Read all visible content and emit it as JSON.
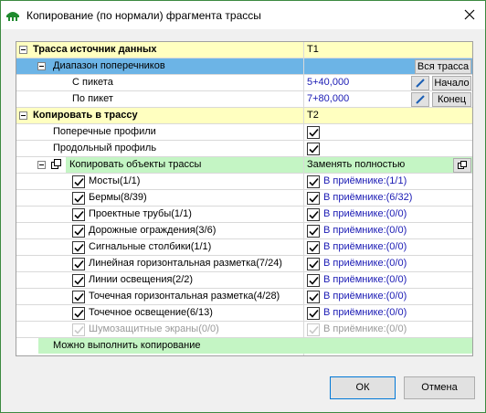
{
  "window": {
    "title": "Копирование (по нормали) фрагмента трассы"
  },
  "rows": {
    "source_label": "Трасса источник данных",
    "source_value": "Т1",
    "range_label": "Диапазон поперечников",
    "range_button": "Вся трасса",
    "from_label": "С пикета",
    "from_value": "5+40,000",
    "from_button": "Начало",
    "to_label": "По пикет",
    "to_value": "7+80,000",
    "to_button": "Конец",
    "target_label": "Копировать в трассу",
    "target_value": "Т2",
    "cross_label": "Поперечные профили",
    "long_label": "Продольный профиль",
    "copy_objects_label": "Копировать объекты трассы",
    "copy_objects_value": "Заменять полностью",
    "footer_label": "Можно выполнить копирование"
  },
  "objects": [
    {
      "label": "Мосты(1/1)",
      "value": "В приёмнике:(1/1)",
      "checked": true,
      "disabled": false
    },
    {
      "label": "Бермы(8/39)",
      "value": "В приёмнике:(6/32)",
      "checked": true,
      "disabled": false
    },
    {
      "label": "Проектные трубы(1/1)",
      "value": "В приёмнике:(0/0)",
      "checked": true,
      "disabled": false
    },
    {
      "label": "Дорожные ограждения(3/6)",
      "value": "В приёмнике:(0/0)",
      "checked": true,
      "disabled": false
    },
    {
      "label": "Сигнальные столбики(1/1)",
      "value": "В приёмнике:(0/0)",
      "checked": true,
      "disabled": false
    },
    {
      "label": "Линейная горизонтальная разметка(7/24)",
      "value": "В приёмнике:(0/0)",
      "checked": true,
      "disabled": false
    },
    {
      "label": "Линии освещения(2/2)",
      "value": "В приёмнике:(0/0)",
      "checked": true,
      "disabled": false
    },
    {
      "label": "Точечная горизонтальная разметка(4/28)",
      "value": "В приёмнике:(0/0)",
      "checked": true,
      "disabled": false
    },
    {
      "label": "Точечное освещение(6/13)",
      "value": "В приёмнике:(0/0)",
      "checked": true,
      "disabled": false
    },
    {
      "label": "Шумозащитные экраны(0/0)",
      "value": "В приёмнике:(0/0)",
      "checked": true,
      "disabled": true
    }
  ],
  "buttons": {
    "ok": "ОК",
    "cancel": "Отмена"
  },
  "icons": {
    "app": "road-app-icon",
    "close": "close-icon",
    "pencil": "pencil-icon",
    "copy": "copy-icon"
  }
}
